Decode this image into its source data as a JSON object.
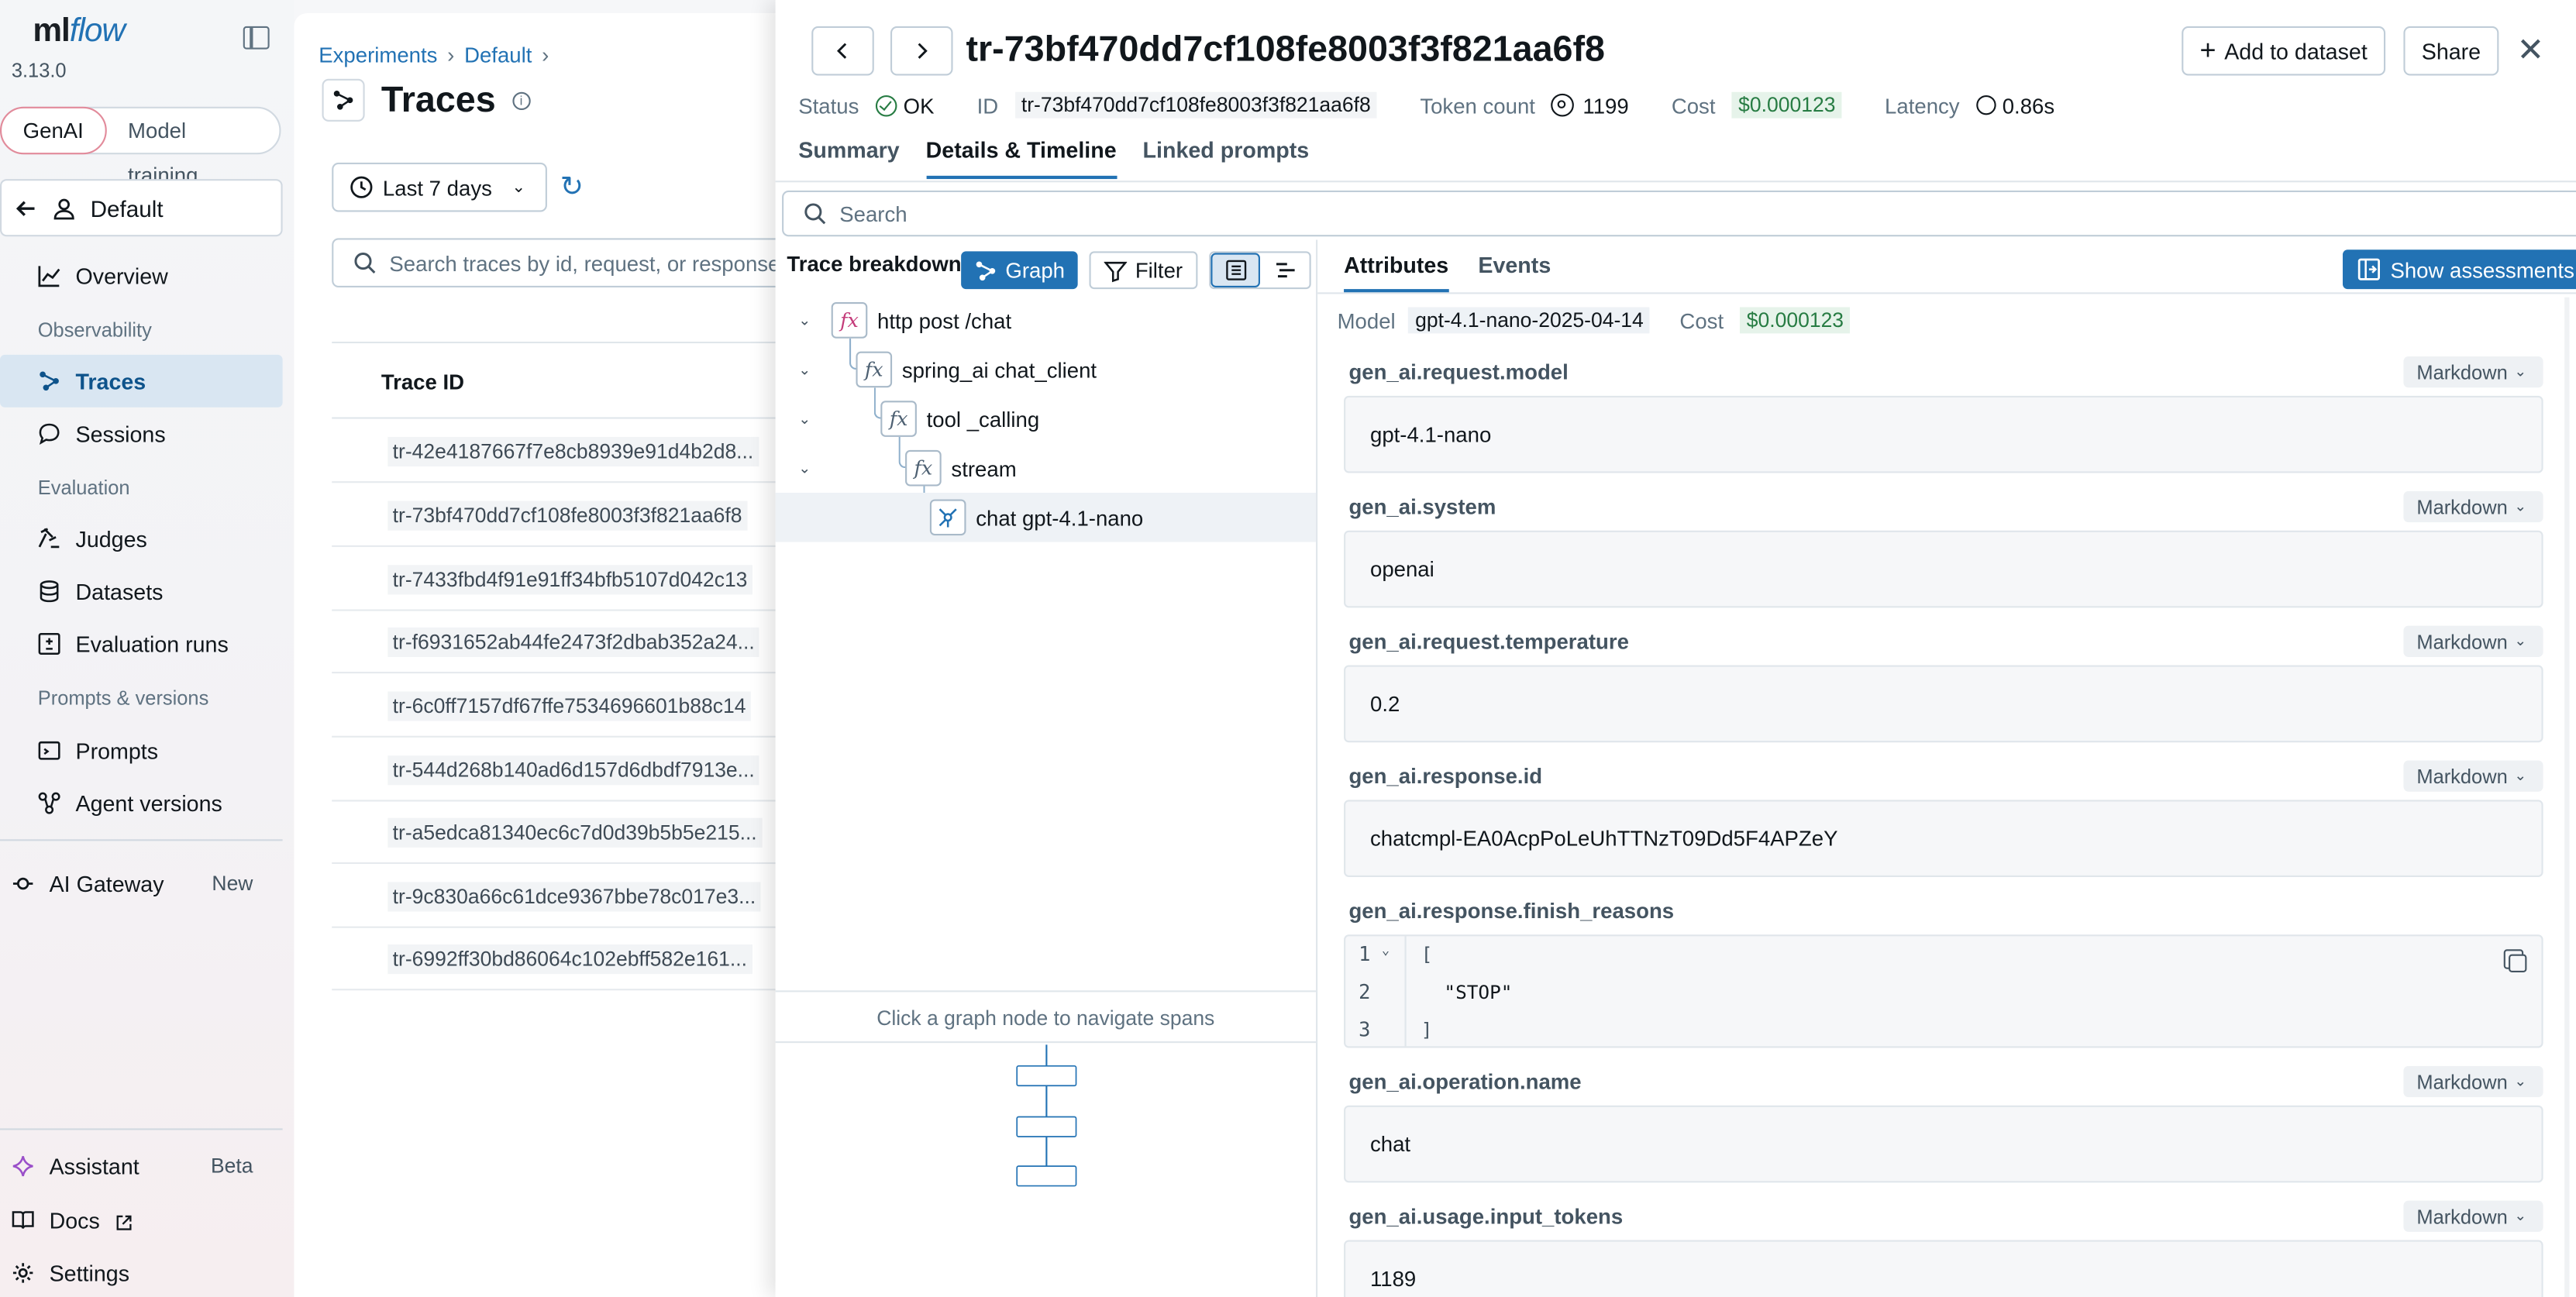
{
  "sidebar": {
    "logo_plain": "ml",
    "logo_italic": "flow",
    "version": "3.13.0",
    "mode_tabs": [
      "GenAI",
      "Model training"
    ],
    "workspace": "Default",
    "overview": "Overview",
    "sec_observability": "Observability",
    "traces": "Traces",
    "sessions": "Sessions",
    "sec_evaluation": "Evaluation",
    "judges": "Judges",
    "datasets": "Datasets",
    "evaluation_runs": "Evaluation runs",
    "sec_prompts": "Prompts & versions",
    "prompts": "Prompts",
    "agent_versions": "Agent versions",
    "ai_gateway": "AI Gateway",
    "ai_gateway_badge": "New",
    "assistant": "Assistant",
    "assistant_badge": "Beta",
    "docs": "Docs",
    "settings": "Settings"
  },
  "main": {
    "breadcrumb": [
      "Experiments",
      "Default"
    ],
    "title": "Traces",
    "date_range": "Last 7 days",
    "search_placeholder": "Search traces by id, request, or response",
    "column_trace_id": "Trace ID",
    "trace_ids": [
      "tr-42e4187667f7e8cb8939e91d4b2d8...",
      "tr-73bf470dd7cf108fe8003f3f821aa6f8",
      "tr-7433fbd4f91e91ff34bfb5107d042c13",
      "tr-f6931652ab44fe2473f2dbab352a24...",
      "tr-6c0ff7157df67ffe7534696601b88c14",
      "tr-544d268b140ad6d157d6dbdf7913e...",
      "tr-a5edca81340ec6c7d0d39b5b5e215...",
      "tr-9c830a66c61dce9367bbe78c017e3...",
      "tr-6992ff30bd86064c102ebff582e161..."
    ]
  },
  "drawer": {
    "title": "tr-73bf470dd7cf108fe8003f3f821aa6f8",
    "add_to_dataset": "Add to dataset",
    "share": "Share",
    "status_label": "Status",
    "status_value": "OK",
    "id_label": "ID",
    "id_value": "tr-73bf470dd7cf108fe8003f3f821aa6f8",
    "token_label": "Token count",
    "token_value": "1199",
    "cost_label": "Cost",
    "cost_value": "$0.000123",
    "latency_label": "Latency",
    "latency_value": "0.86s",
    "tabs": [
      "Summary",
      "Details & Timeline",
      "Linked prompts"
    ],
    "search_placeholder": "Search",
    "breakdown_label": "Trace breakdown",
    "graph_label": "Graph",
    "filter_label": "Filter",
    "spans": [
      "http post /chat",
      "spring_ai chat_client",
      "tool _calling",
      "stream",
      "chat gpt-4.1-nano"
    ],
    "graph_caption": "Click a graph node to navigate spans",
    "attr_tabs": [
      "Attributes",
      "Events"
    ],
    "show_assessments": "Show assessments",
    "model_label": "Model",
    "model_value": "gpt-4.1-nano-2025-04-14",
    "model_cost_label": "Cost",
    "model_cost_value": "$0.000123",
    "format_label": "Markdown",
    "attributes": [
      {
        "key": "gen_ai.request.model",
        "value": "gpt-4.1-nano"
      },
      {
        "key": "gen_ai.system",
        "value": "openai"
      },
      {
        "key": "gen_ai.request.temperature",
        "value": "0.2"
      },
      {
        "key": "gen_ai.response.id",
        "value": "chatcmpl-EA0AcpPoLeUhTTNzT09Dd5F4APZeY"
      },
      {
        "key": "gen_ai.response.finish_reasons",
        "code": [
          "[",
          "\"STOP\"",
          "]"
        ],
        "line_numbers": [
          "1",
          "2",
          "3"
        ]
      },
      {
        "key": "gen_ai.operation.name",
        "value": "chat"
      },
      {
        "key": "gen_ai.usage.input_tokens",
        "value": "1189"
      }
    ]
  }
}
